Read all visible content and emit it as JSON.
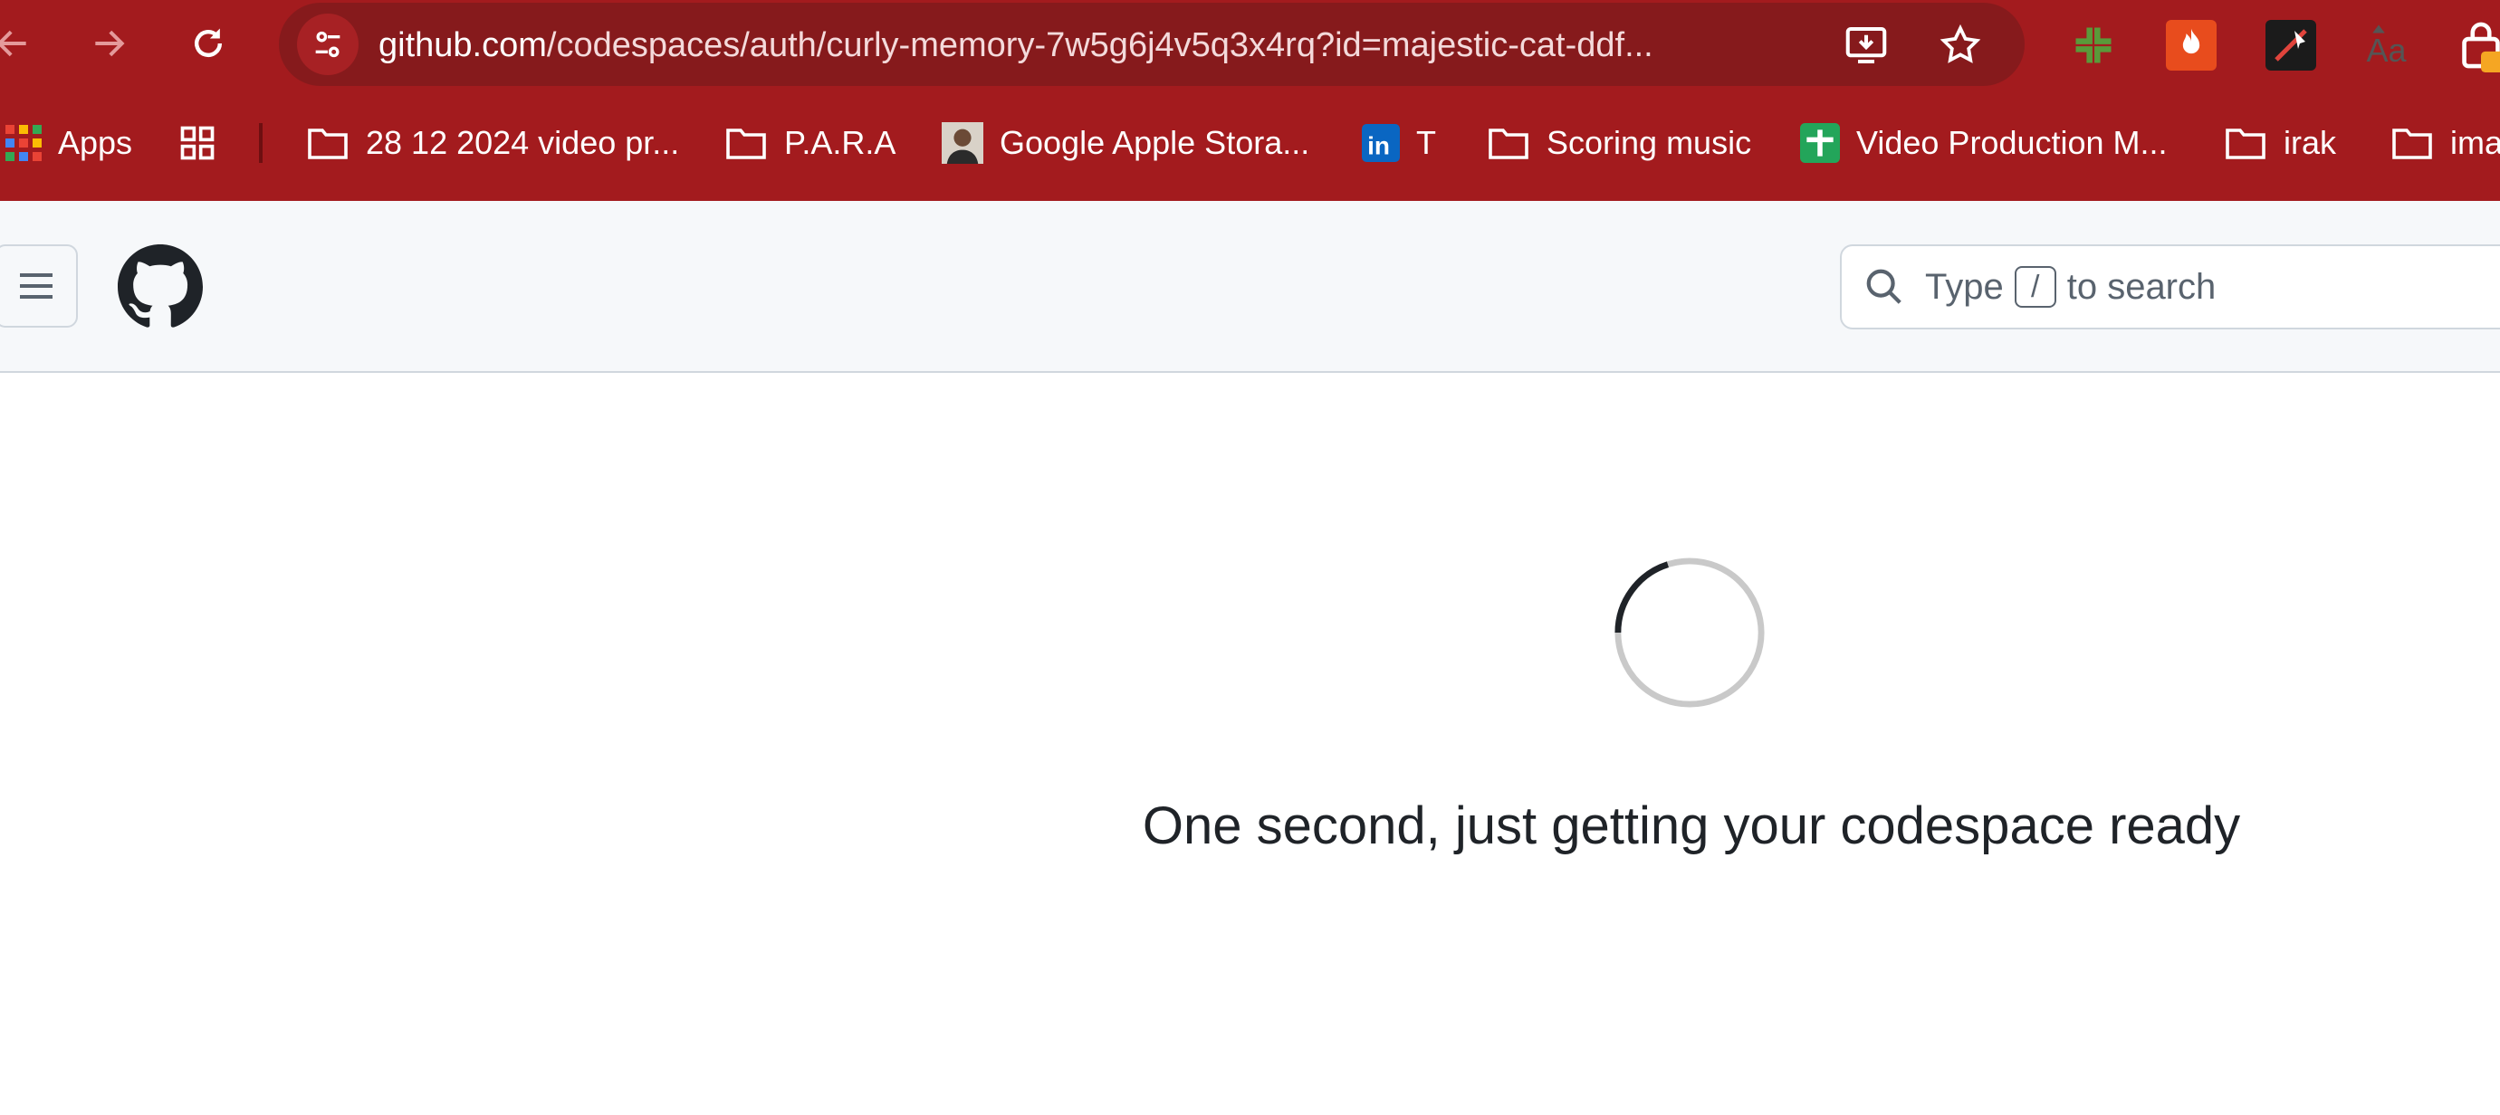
{
  "browser": {
    "url_host": "github.com",
    "url_path": "/codespaces/auth/curly-memory-7w5g6j4v5q3x4rq?id=majestic-cat-ddf...",
    "bookmarks": [
      {
        "label": "Apps",
        "icon": "apps-grid-icon"
      },
      {
        "label": "",
        "icon": "tab-groups-icon"
      },
      {
        "label": "28 12 2024 video pr...",
        "icon": "folder-icon"
      },
      {
        "label": "P.A.R.A",
        "icon": "folder-icon"
      },
      {
        "label": "Google Apple Stora...",
        "icon": "profile-photo-icon"
      },
      {
        "label": "T",
        "icon": "linkedin-icon"
      },
      {
        "label": "Scoring music",
        "icon": "folder-icon"
      },
      {
        "label": "Video Production M...",
        "icon": "google-sheets-icon"
      },
      {
        "label": "irak",
        "icon": "folder-icon"
      },
      {
        "label": "ima",
        "icon": "folder-icon"
      }
    ]
  },
  "github": {
    "search_type": "Type",
    "search_key": "/",
    "search_rest": "to search"
  },
  "main": {
    "message": "One second, just getting your codespace ready"
  },
  "colors": {
    "chrome_bg": "#a31b1e",
    "omnibox_bg": "#861a1c",
    "header_bg": "#f6f8fa",
    "text": "#1f2328"
  }
}
